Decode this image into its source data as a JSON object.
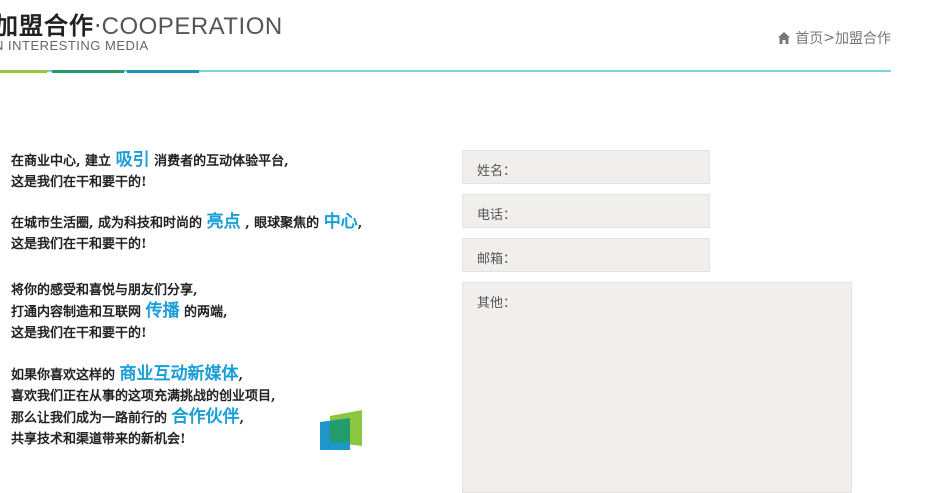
{
  "header": {
    "title_zh": "加盟合作",
    "title_sep": "·",
    "title_en": "COOPERATION",
    "subtitle": "N INTERESTING MEDIA"
  },
  "breadcrumb": {
    "home_icon": "home-icon",
    "home": "首页",
    "separator": ">",
    "current": "加盟合作"
  },
  "divider_colors": [
    "#9ac43b",
    "#239b6a",
    "#1e96b4",
    "#7ccfdc"
  ],
  "accent_color": "#1a9ed8",
  "intro": {
    "p1": {
      "l1a": "在商业中心, 建立 ",
      "l1hl": "吸引",
      "l1b": " 消费者的互动体验平台,",
      "l2": "这是我们在干和要干的!"
    },
    "p2": {
      "l1a": "在城市生活圈, 成为科技和时尚的 ",
      "l1hl1": "亮点",
      "l1b": " ,  眼球聚焦的 ",
      "l1hl2": "中心",
      "l1c": ",",
      "l2": "这是我们在干和要干的!"
    },
    "p3": {
      "l1": "将你的感受和喜悦与朋友们分享,",
      "l2a": "打通内容制造和互联网 ",
      "l2hl": "传播",
      "l2b": " 的两端,",
      "l3": "这是我们在干和要干的!"
    },
    "p4": {
      "l1a": "如果你喜欢这样的 ",
      "l1hl": "商业互动新媒体",
      "l1b": ",",
      "l2": "喜欢我们正在从事的这项充满挑战的创业项目,",
      "l3a": "那么让我们成为一路前行的 ",
      "l3hl": "合作伙伴",
      "l3b": ",",
      "l4": "共享技术和渠道带来的新机会!"
    }
  },
  "form": {
    "name_label": "姓名：",
    "phone_label": "电话：",
    "email_label": "邮箱：",
    "other_label": "其他：",
    "name_value": "",
    "phone_value": "",
    "email_value": "",
    "other_value": ""
  }
}
